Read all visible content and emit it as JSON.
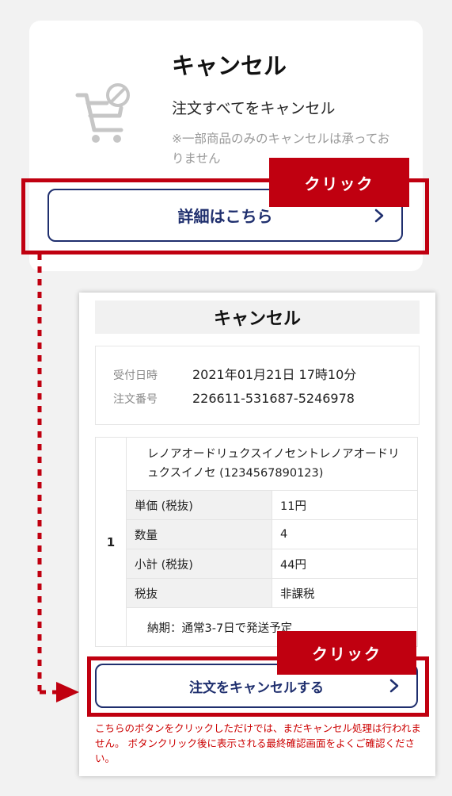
{
  "top_card": {
    "title": "キャンセル",
    "subtitle": "注文すべてをキャンセル",
    "note": "※一部商品のみのキャンセルは承っておりません",
    "detail_button": "詳細はこちら",
    "icon": "cart-cancel-icon"
  },
  "annotations": {
    "click_label_1": "クリック",
    "click_label_2": "クリック"
  },
  "panel": {
    "title": "キャンセル",
    "order_info": {
      "received_label": "受付日時",
      "received_value": "2021年01月21日 17時10分",
      "order_no_label": "注文番号",
      "order_no_value": "226611-531687-5246978"
    },
    "item": {
      "index": "1",
      "name": "レノアオードリュクスイノセントレノアオードリュクスイノセ (1234567890123)",
      "rows": [
        {
          "key": "単価 (税抜)",
          "value": "11円"
        },
        {
          "key": "数量",
          "value": "4"
        },
        {
          "key": "小計 (税抜)",
          "value": "44円"
        },
        {
          "key": "税抜",
          "value": "非課税"
        }
      ],
      "delivery": "納期：通常3-7日で発送予定"
    },
    "cancel_button": "注文をキャンセルする",
    "warning": "こちらのボタンをクリックしただけでは、まだキャンセル処理は行われません。 ボタンクリック後に表示される最終確認画面をよくご確認ください。"
  },
  "colors": {
    "accent_red": "#c00010",
    "navy": "#1f2f6e",
    "warning_red": "#cc0000"
  }
}
